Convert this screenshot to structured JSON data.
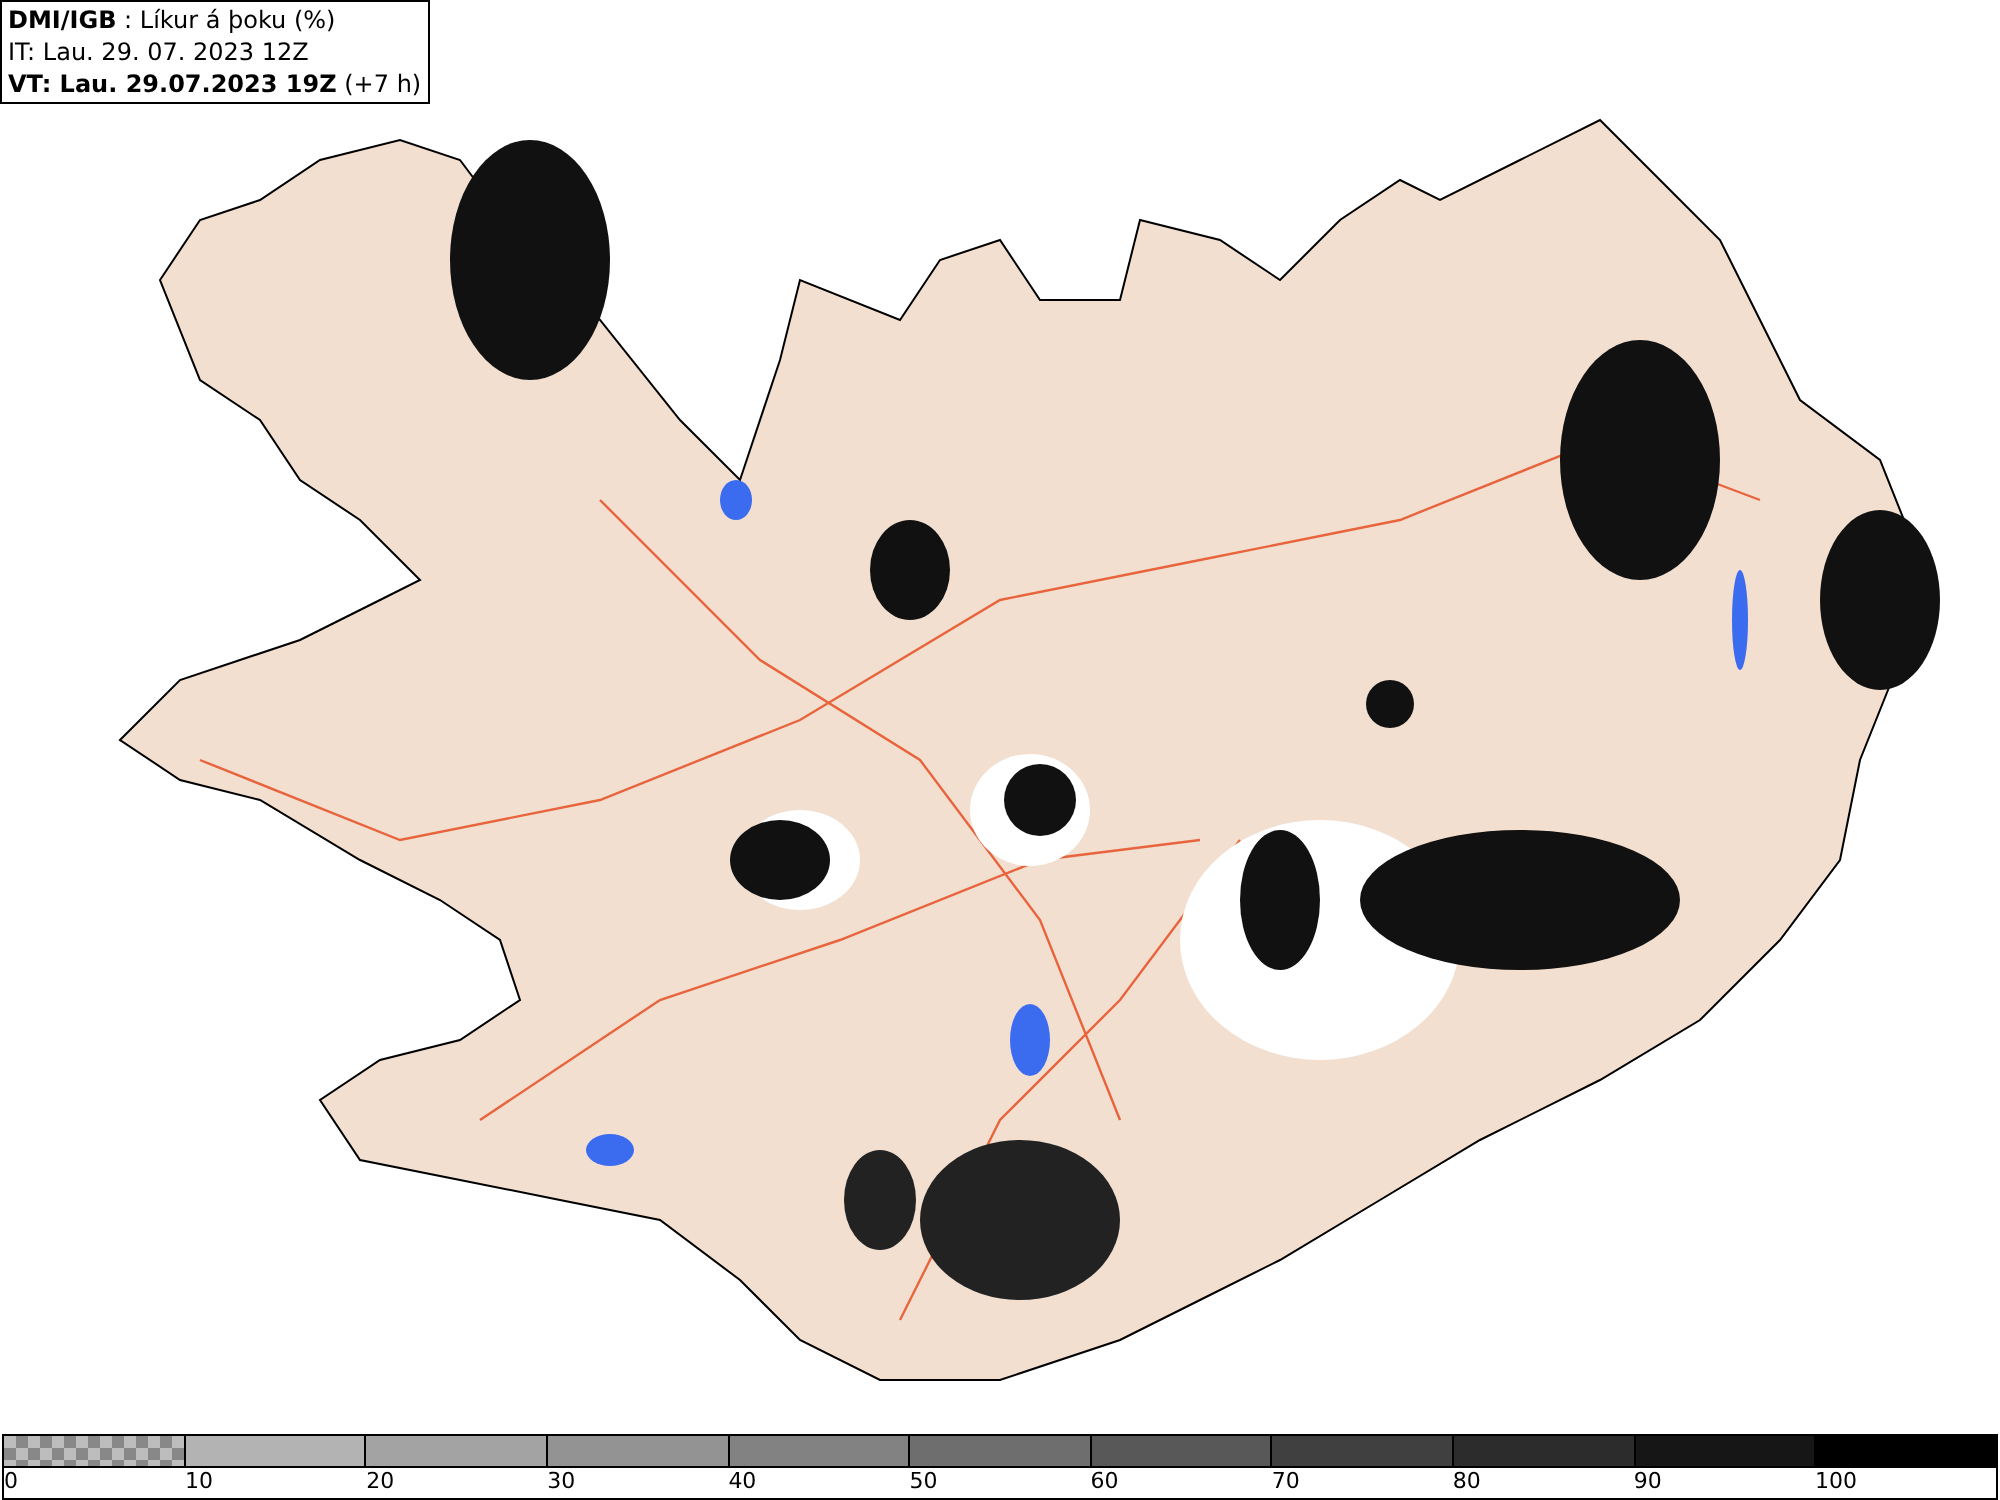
{
  "info_box": {
    "title": "**DMI/IGB** : Líkur á þoku (%)",
    "initial_time": "IT: Lau. 29. 07. 2023 12Z",
    "valid_time": "**VT: Lau. 29.07.2023 19Z** (+7 h)"
  },
  "legend": [
    {
      "kind": "checker",
      "color": "#bdbdbd",
      "label": "0"
    },
    {
      "kind": "solid",
      "color": "#b3b3b3",
      "label": "10"
    },
    {
      "kind": "solid",
      "color": "#a3a3a3",
      "label": "20"
    },
    {
      "kind": "solid",
      "color": "#939393",
      "label": "30"
    },
    {
      "kind": "solid",
      "color": "#828282",
      "label": "40"
    },
    {
      "kind": "solid",
      "color": "#6e6e6e",
      "label": "50"
    },
    {
      "kind": "solid",
      "color": "#585858",
      "label": "60"
    },
    {
      "kind": "solid",
      "color": "#404040",
      "label": "70"
    },
    {
      "kind": "solid",
      "color": "#2c2c2c",
      "label": "80"
    },
    {
      "kind": "solid",
      "color": "#161616",
      "label": "90"
    },
    {
      "kind": "solid",
      "color": "#000000",
      "label": "100"
    }
  ]
}
